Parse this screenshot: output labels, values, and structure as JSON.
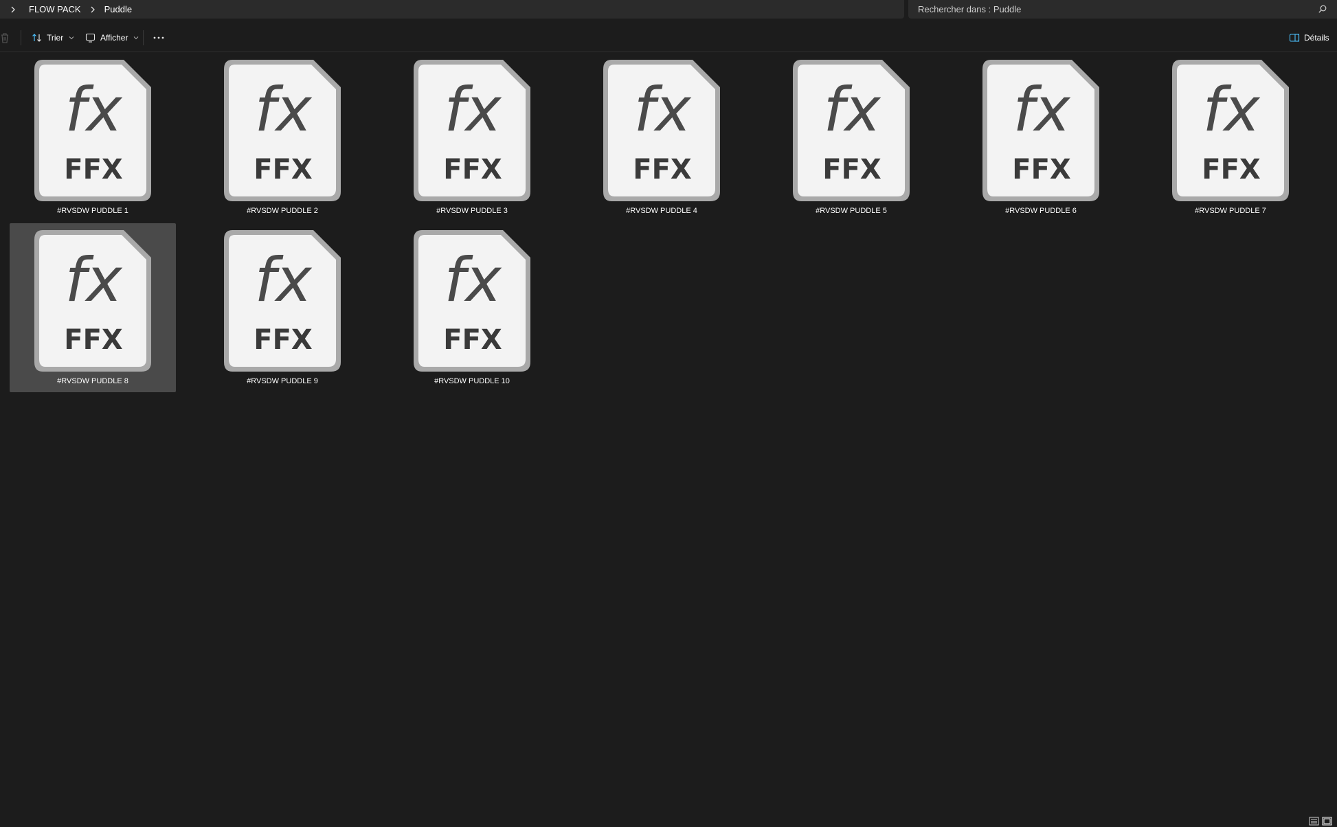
{
  "breadcrumb": {
    "items": [
      "FLOW PACK",
      "Puddle"
    ]
  },
  "search": {
    "placeholder": "Rechercher dans : Puddle"
  },
  "toolbar": {
    "sort_label": "Trier",
    "view_label": "Afficher",
    "details_label": "Détails"
  },
  "file_icon": {
    "glyph": "fx",
    "ext": "FFX"
  },
  "files": [
    {
      "name": "#RVSDW PUDDLE 1",
      "selected": false
    },
    {
      "name": "#RVSDW PUDDLE 2",
      "selected": false
    },
    {
      "name": "#RVSDW PUDDLE 3",
      "selected": false
    },
    {
      "name": "#RVSDW PUDDLE 4",
      "selected": false
    },
    {
      "name": "#RVSDW PUDDLE 5",
      "selected": false
    },
    {
      "name": "#RVSDW PUDDLE 6",
      "selected": false
    },
    {
      "name": "#RVSDW PUDDLE 7",
      "selected": false
    },
    {
      "name": "#RVSDW PUDDLE 8",
      "selected": true
    },
    {
      "name": "#RVSDW PUDDLE 9",
      "selected": false
    },
    {
      "name": "#RVSDW PUDDLE 10",
      "selected": false
    }
  ],
  "colors": {
    "accent": "#4cc2ff",
    "background": "#1c1c1c",
    "selection": "#4a4a4a"
  }
}
